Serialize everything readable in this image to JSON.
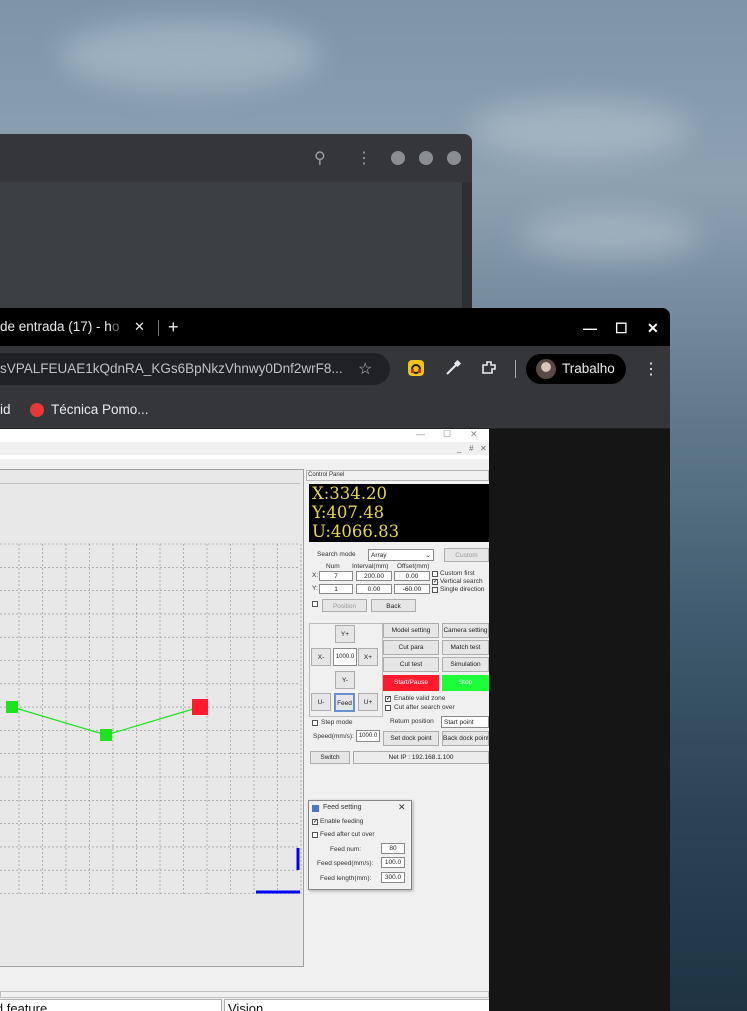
{
  "back_window": {
    "icons": [
      "search-icon",
      "kebab-menu-icon",
      "window-dot-icon",
      "window-dot-icon",
      "window-dot-icon"
    ]
  },
  "browser": {
    "tab": {
      "title_visible": "de entrada (17) - h",
      "title_faded": "o"
    },
    "close_tab_glyph": "✕",
    "new_tab_glyph": "+",
    "window_controls": {
      "minimize": "—",
      "maximize": "☐",
      "close": "✕"
    },
    "url": "sVPALFEUAE1kQdnRA_KGs6BpNkzVhnwy0Dnf2wrF8...",
    "profile_name": "Trabalho",
    "bookmarks": [
      {
        "label": "id"
      },
      {
        "label": "Técnica Pomo..."
      }
    ]
  },
  "app": {
    "title_controls": [
      "—",
      "☐",
      "✕"
    ],
    "inner_controls": [
      "_",
      "#",
      "✕"
    ],
    "control_panel_label": "Control Panel",
    "coords": {
      "x": "X:334.20",
      "y": "Y:407.48",
      "u": "U:4066.83"
    },
    "search_mode_label": "Search mode",
    "search_mode_value": "Array",
    "custom_label": "Custom",
    "col_num": "Num",
    "col_interval": "Interval(mm)",
    "col_offset": "Offset(mm)",
    "row_x": {
      "label": "X:",
      "num": "7",
      "interval": "200.00",
      "offset": "0.00"
    },
    "row_y": {
      "label": "Y:",
      "num": "1",
      "interval": "0.00",
      "offset": "-60.00"
    },
    "custom_first": "Custom first",
    "vertical_search": "Vertical search",
    "single_direction": "Single direction",
    "position_btn": "Position",
    "back_btn": "Back",
    "jog": {
      "y_plus": "Y+",
      "y_minus": "Y-",
      "x_minus": "X-",
      "x_plus": "X+",
      "step": "1000.0",
      "u_minus": "U-",
      "feed": "Feed",
      "u_plus": "U+"
    },
    "model_setting": "Model setting",
    "camera_setting": "Camera setting",
    "cut_para": "Cut para",
    "match_test": "Match test",
    "cut_test": "Cut test",
    "simulation": "Simulation",
    "start_pause": "Start/Pause",
    "stop": "Stop",
    "enable_valid_zone": "Enable valid zone",
    "cut_after_search_over": "Cut after search over",
    "return_position_label": "Return position",
    "return_position_value": "Start point",
    "step_mode": "Step mode",
    "speed_label": "Speed(mm/s):",
    "speed_value": "1000.0",
    "set_dock_point": "Set dock point",
    "back_dock_point": "Back dock point",
    "switch_btn": "Switch",
    "net_ip": "Net IP : 192.168.1.100",
    "feed_dialog": {
      "title": "Feed setting",
      "close": "✕",
      "enable_feeding": "Enable feeding",
      "feed_after_cut_over": "Feed after cut over",
      "feed_num_label": "Feed num:",
      "feed_num": "80",
      "feed_speed_label": "Feed speed(mm/s):",
      "feed_speed": "100.0",
      "feed_length_label": "Feed length(mm):",
      "feed_length": "300.0"
    },
    "bottom_tabs": [
      "ld feature",
      "Vision"
    ]
  },
  "colors": {
    "coord_text": "#e5d44d",
    "start_btn": "#ff1a2e",
    "stop_btn": "#1aff3a",
    "path_line": "#1fe21f",
    "marker_red": "#ff1a2e",
    "axis_blue": "#0000ff"
  }
}
